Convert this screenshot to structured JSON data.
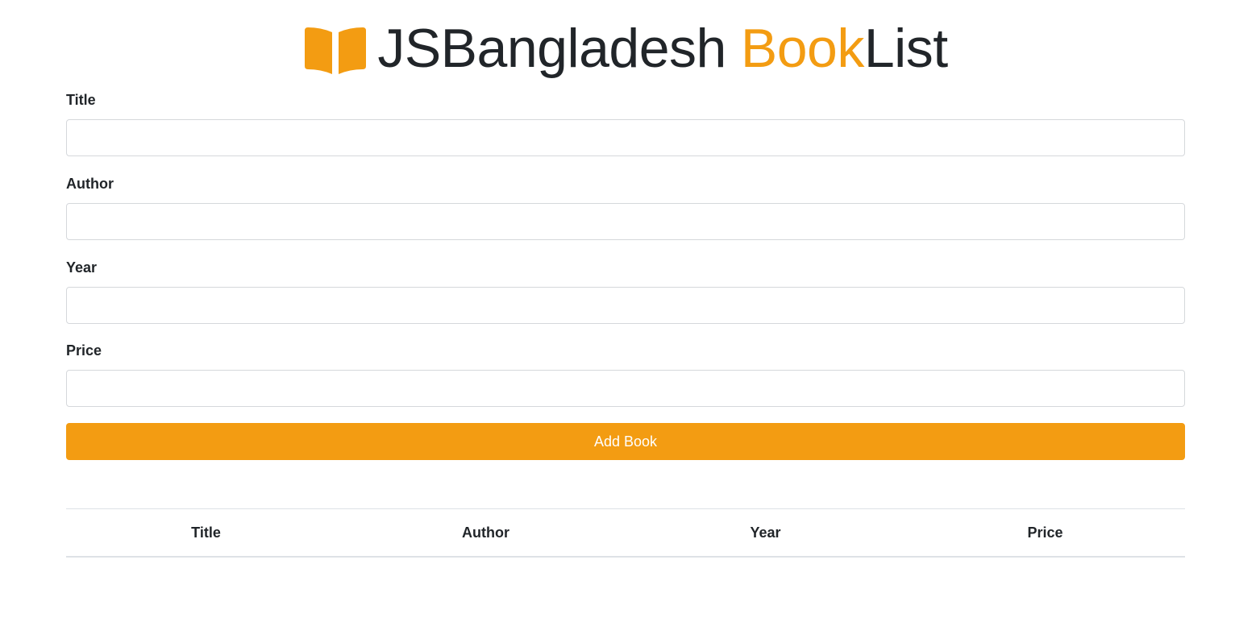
{
  "header": {
    "brand_part_1": "JSBangladesh",
    "brand_part_2": "Book",
    "brand_part_3": "List",
    "icon": "book-open-icon",
    "accent_color": "#f39c12",
    "text_color": "#212529"
  },
  "form": {
    "title_label": "Title",
    "title_value": "",
    "author_label": "Author",
    "author_value": "",
    "year_label": "Year",
    "year_value": "",
    "price_label": "Price",
    "price_value": "",
    "submit_label": "Add Book"
  },
  "table": {
    "columns": [
      "Title",
      "Author",
      "Year",
      "Price"
    ],
    "rows": []
  }
}
